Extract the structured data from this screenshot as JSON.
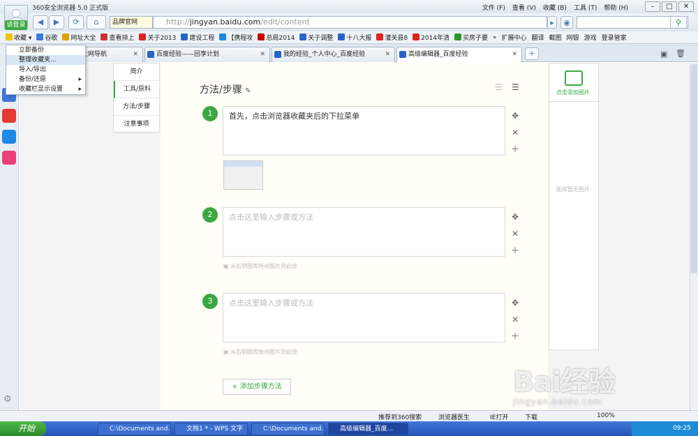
{
  "window": {
    "title": "360安全浏览器 5.0 正式版",
    "menus": [
      "文件 (F)",
      "查看 (V)",
      "收藏 (B)",
      "工具 (T)",
      "帮助 (H)"
    ],
    "login_label": "请登录"
  },
  "address": {
    "brand": "品牌官网",
    "url": "http://jingyan.baidu.com/edit/content",
    "url_host": "jingyan.baidu.com",
    "url_pre": "http://",
    "url_post": "/edit/content"
  },
  "favorites": {
    "menu_label": "收藏",
    "items": [
      "谷歌",
      "网址大全",
      "查看排上",
      "关于2013",
      "建设工程",
      "【携程攻",
      "总局2014",
      "关于调整",
      "十八大报",
      "灌关县8",
      "2014年清",
      "买房子要"
    ],
    "right": [
      "扩展中心",
      "翻译",
      "截图",
      "网银",
      "游戏",
      "登录管家"
    ]
  },
  "dropdown": {
    "items": [
      "立即备份",
      "整理收藏夹...",
      "导入/导出",
      "备份/还原",
      "收藏栏显示设置"
    ]
  },
  "tabs": [
    {
      "label": "上网导航"
    },
    {
      "label": "百度经验——回享计划"
    },
    {
      "label": "我的经验_个人中心_百度经验"
    },
    {
      "label": "高级编辑器_百度经验"
    }
  ],
  "sidenav": [
    "简介",
    "工具/原料",
    "方法/步骤",
    "注意事项"
  ],
  "editor": {
    "section_title": "方法/步骤",
    "add_step": "+ 添加步骤方法",
    "steps": [
      {
        "num": "1",
        "text": "首先，点击浏览器收藏夹后的下拉菜单"
      },
      {
        "num": "2",
        "placeholder": "点击这里输入步骤或方法"
      },
      {
        "num": "3",
        "placeholder": "点击这里输入步骤或方法"
      }
    ],
    "drag_hint": "从右侧图库拖动图片到此处"
  },
  "rightpanel": {
    "add_image": "点击添加图片",
    "empty": "图库暂无图片"
  },
  "statusbar": {
    "items": [
      "推荐到360搜索",
      "浏览器医生",
      "IE打开",
      "下载"
    ],
    "zoom": "100%"
  },
  "taskbar": {
    "start": "开始",
    "tasks": [
      "C:\\Documents and...",
      "文档1 * - WPS 文字",
      "C:\\Documents and...",
      "高级编辑器_百度..."
    ],
    "clock": "09:25"
  },
  "watermark": {
    "text": "Bai经验",
    "sub": "jingyan.baidu.com"
  }
}
